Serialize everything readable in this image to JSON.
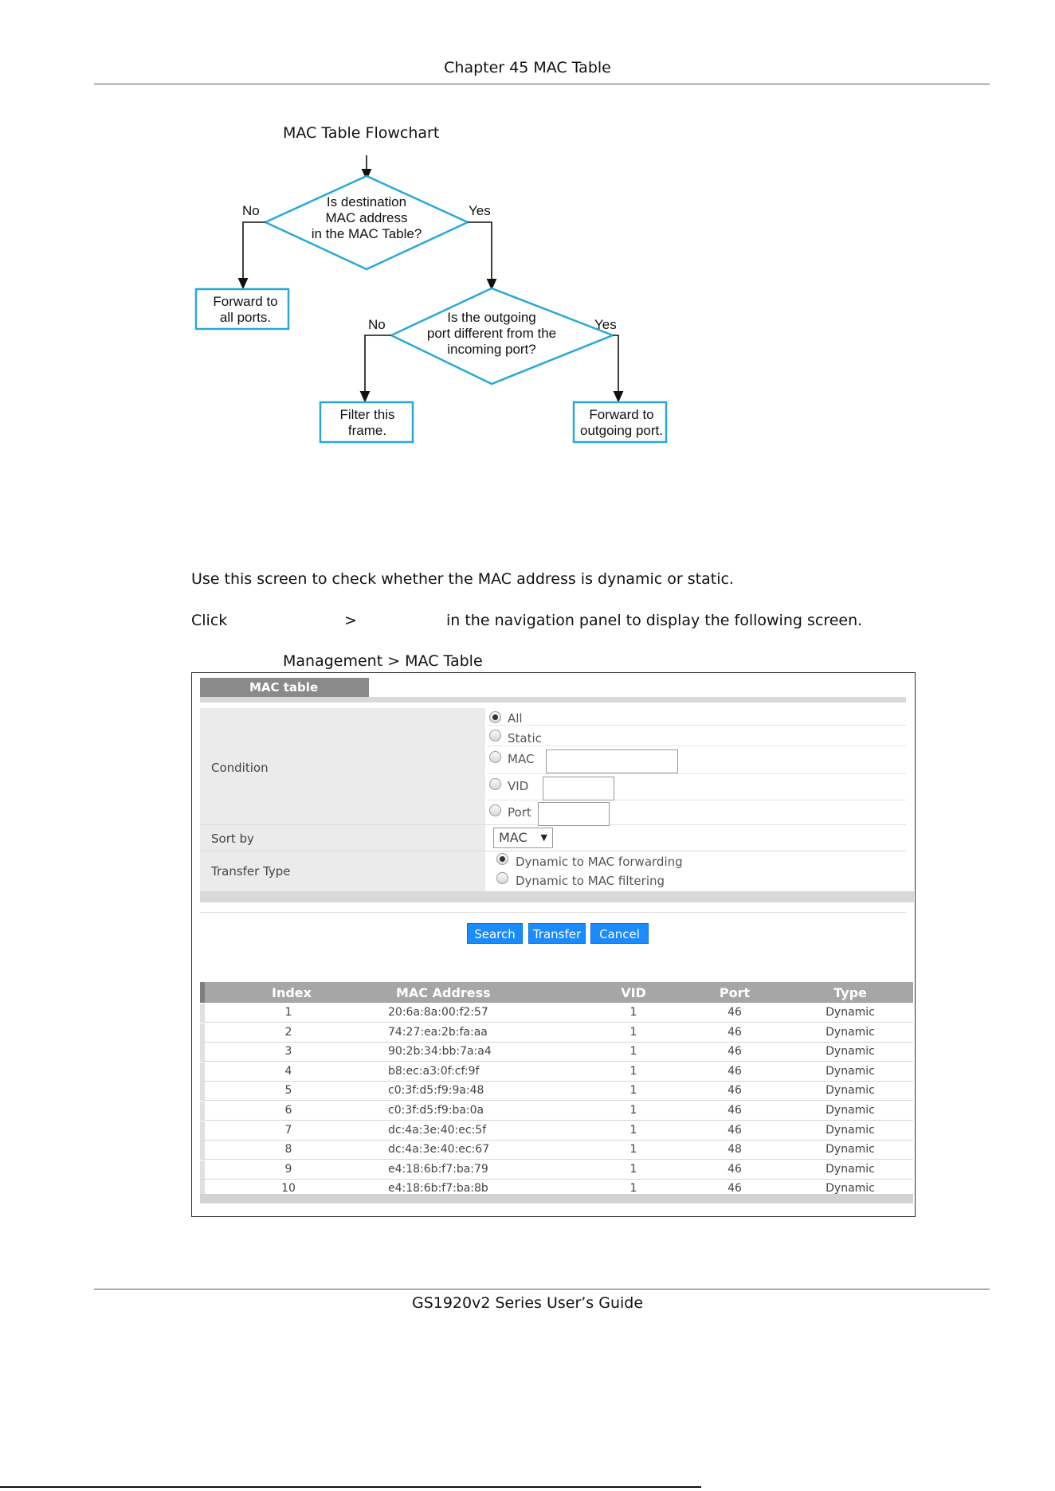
{
  "page": {
    "chapter_header": "Chapter 45 MAC Table",
    "footer": "GS1920v2 Series User’s Guide"
  },
  "flowchart": {
    "title": "MAC Table Flowchart",
    "decision1": [
      "Is destination",
      "MAC address",
      "in the MAC Table?"
    ],
    "decision1_no": "No",
    "decision1_yes": "Yes",
    "forward_all": [
      "Forward to",
      "all ports."
    ],
    "decision2": [
      "Is the outgoing",
      "port different from the",
      "incoming port?"
    ],
    "decision2_no": "No",
    "decision2_yes": "Yes",
    "filter": [
      "Filter this",
      "frame."
    ],
    "forward_out": [
      "Forward to",
      "outgoing port."
    ]
  },
  "text": {
    "intro": "Use this screen to check whether the MAC address is dynamic or static.",
    "click_word": "Click",
    "click_sep": ">",
    "click_rest": "in the navigation panel to display the following screen.",
    "figure_caption": "Management > MAC Table"
  },
  "screen": {
    "tab_label": "MAC table",
    "condition_label": "Condition",
    "sort_by_label": "Sort by",
    "transfer_type_label": "Transfer Type",
    "condition_options": [
      "All",
      "Static",
      "MAC",
      "VID",
      "Port"
    ],
    "condition_selected": "All",
    "mac_value": "",
    "vid_value": "",
    "port_value": "",
    "sort_by_value": "MAC",
    "transfer_options": [
      "Dynamic to MAC forwarding",
      "Dynamic to MAC filtering"
    ],
    "transfer_selected": "Dynamic to MAC forwarding",
    "buttons": {
      "search": "Search",
      "transfer": "Transfer",
      "cancel": "Cancel"
    },
    "table": {
      "headers": [
        "Index",
        "MAC Address",
        "VID",
        "Port",
        "Type"
      ],
      "rows": [
        [
          "1",
          "20:6a:8a:00:f2:57",
          "1",
          "46",
          "Dynamic"
        ],
        [
          "2",
          "74:27:ea:2b:fa:aa",
          "1",
          "46",
          "Dynamic"
        ],
        [
          "3",
          "90:2b:34:bb:7a:a4",
          "1",
          "46",
          "Dynamic"
        ],
        [
          "4",
          "b8:ec:a3:0f:cf:9f",
          "1",
          "46",
          "Dynamic"
        ],
        [
          "5",
          "c0:3f:d5:f9:9a:48",
          "1",
          "46",
          "Dynamic"
        ],
        [
          "6",
          "c0:3f:d5:f9:ba:0a",
          "1",
          "46",
          "Dynamic"
        ],
        [
          "7",
          "dc:4a:3e:40:ec:5f",
          "1",
          "46",
          "Dynamic"
        ],
        [
          "8",
          "dc:4a:3e:40:ec:67",
          "1",
          "48",
          "Dynamic"
        ],
        [
          "9",
          "e4:18:6b:f7:ba:79",
          "1",
          "46",
          "Dynamic"
        ],
        [
          "10",
          "e4:18:6b:f7:ba:8b",
          "1",
          "46",
          "Dynamic"
        ]
      ]
    }
  },
  "colors": {
    "flow_line": "#2aa8d8",
    "button": "#1a8cff",
    "header_gray": "#a6a6a6"
  }
}
